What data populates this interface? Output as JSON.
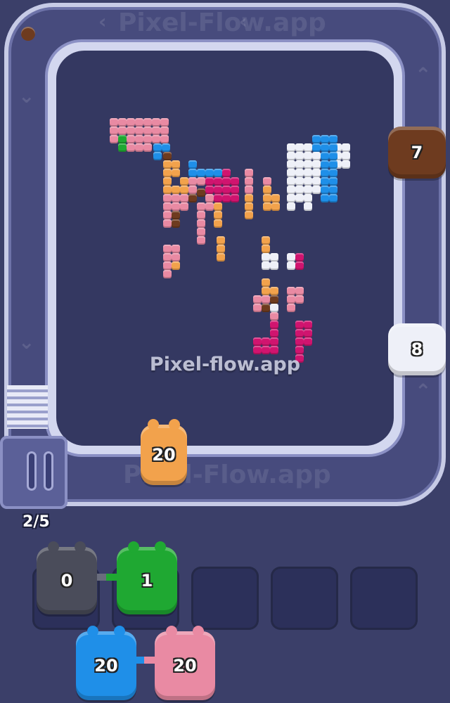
{
  "watermark": "Pixel-flow.app",
  "track_watermark_top": "Pixel-Flow.app",
  "track_watermark_bottom": "Pixel-Flow.app",
  "queue": {
    "count_text": "2/5"
  },
  "colors": {
    "pink": "#e98aa3",
    "magenta": "#d0146f",
    "orange": "#f2a24c",
    "brown": "#6e3b1f",
    "blue": "#1f8fe8",
    "white": "#eef0f8",
    "green": "#1fa832",
    "gray": "#4a4c5a"
  },
  "track_shooters": [
    {
      "name": "brown-pig",
      "number": "7",
      "color": "brown"
    },
    {
      "name": "white-pig",
      "number": "8",
      "color": "white"
    },
    {
      "name": "orange-pig",
      "number": "20",
      "color": "orange"
    }
  ],
  "slot_shooters": [
    {
      "name": "gray-pig",
      "number": "0",
      "color": "gray"
    },
    {
      "name": "green-pig",
      "number": "1",
      "color": "green"
    }
  ],
  "queue_shooters": [
    {
      "name": "blue-pig",
      "number": "20",
      "color": "blue"
    },
    {
      "name": "pink-pig",
      "number": "20",
      "color": "pink"
    }
  ],
  "slots": [
    "slot-1",
    "slot-2",
    "slot-3",
    "slot-4",
    "slot-5"
  ]
}
